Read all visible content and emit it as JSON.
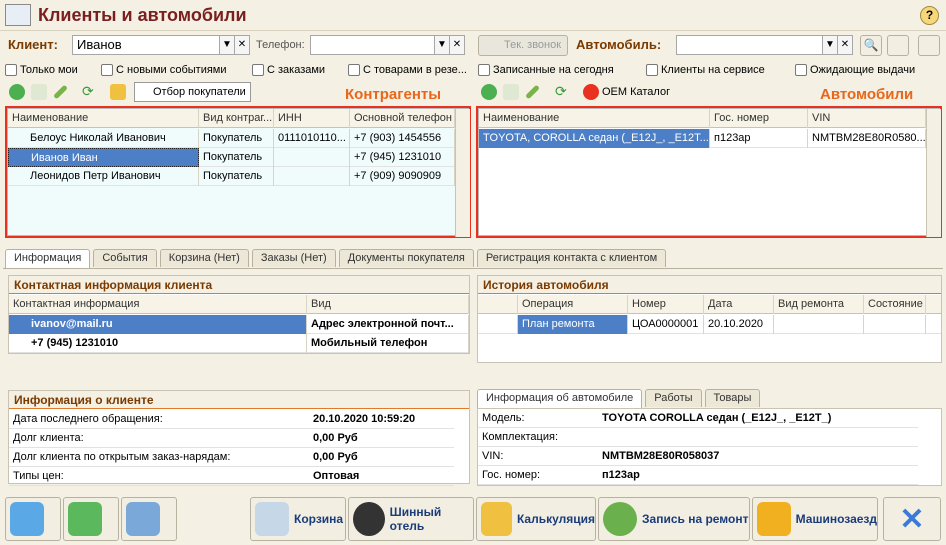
{
  "window_title": "Клиенты и автомобили",
  "client": {
    "label": "Клиент:",
    "value": "Иванов",
    "phone_label": "Телефон:",
    "phone_value": "",
    "call_btn": "Тек. звонок"
  },
  "car": {
    "label": "Автомобиль:",
    "value": ""
  },
  "filters": [
    "Только мои",
    "С новыми событиями",
    "С заказами",
    "С товарами в резе..."
  ],
  "car_filters": [
    "Записанные на сегодня",
    "Клиенты на сервисе",
    "Ожидающие выдачи"
  ],
  "buyer_filter_btn": "Отбор покупатели",
  "oem_btn": "OEM Каталог",
  "counterparties_label": "Контрагенты",
  "cars_label": "Автомобили",
  "clients_cols": [
    "Наименование",
    "Вид контраг...",
    "ИНН",
    "Основной телефон"
  ],
  "clients_rows": [
    [
      "Белоус Николай Иванович",
      "Покупатель",
      "0111010110...",
      "+7 (903) 1454556"
    ],
    [
      "Иванов Иван",
      "Покупатель",
      "",
      "+7 (945) 1231010"
    ],
    [
      "Леонидов Петр Иванович",
      "Покупатель",
      "",
      "+7 (909) 9090909"
    ]
  ],
  "cars_cols": [
    "Наименование",
    "Гос. номер",
    "VIN"
  ],
  "cars_rows": [
    [
      "TOYOTA, COROLLA седан (_E12J_, _E12T...",
      "п123ар",
      "NMTBM28E80R0580..."
    ]
  ],
  "tabs": [
    "Информация",
    "События",
    "Корзина (Нет)",
    "Заказы (Нет)",
    "Документы покупателя",
    "Регистрация контакта с клиентом"
  ],
  "contact": {
    "title": "Контактная информация клиента",
    "cols": [
      "Контактная информация",
      "Вид"
    ],
    "rows": [
      [
        "ivanov@mail.ru",
        "Адрес электронной почт..."
      ],
      [
        "+7 (945) 1231010",
        "Мобильный телефон"
      ]
    ]
  },
  "history": {
    "title": "История автомобиля",
    "cols": [
      "Операция",
      "Номер",
      "Дата",
      "Вид ремонта",
      "Состояние"
    ],
    "rows": [
      [
        "План ремонта",
        "ЦОА0000001",
        "20.10.2020",
        "",
        ""
      ]
    ]
  },
  "client_info": {
    "title": "Информация о клиенте",
    "rows": [
      [
        "Дата последнего обращения:",
        "20.10.2020 10:59:20"
      ],
      [
        "Долг клиента:",
        "0,00 Руб"
      ],
      [
        "Долг клиента по открытым заказ-нарядам:",
        "0,00 Руб"
      ],
      [
        "Типы цен:",
        "Оптовая"
      ]
    ]
  },
  "car_tabs": [
    "Информация об автомобиле",
    "Работы",
    "Товары"
  ],
  "car_info": {
    "rows": [
      [
        "Модель:",
        "TOYOTA COROLLA седан (_E12J_, _E12T_)"
      ],
      [
        "Комплектация:",
        ""
      ],
      [
        "VIN:",
        "NMTBM28E80R058037"
      ],
      [
        "Гос. номер:",
        "п123ар"
      ]
    ]
  },
  "bottom_buttons": [
    "Корзина",
    "Шинный отель",
    "Калькуляция",
    "Запись на ремонт",
    "Машинозаезд"
  ],
  "colors": {
    "accent": "#e8321f",
    "select": "#4d7fc6",
    "title": "#7a1e1e"
  }
}
